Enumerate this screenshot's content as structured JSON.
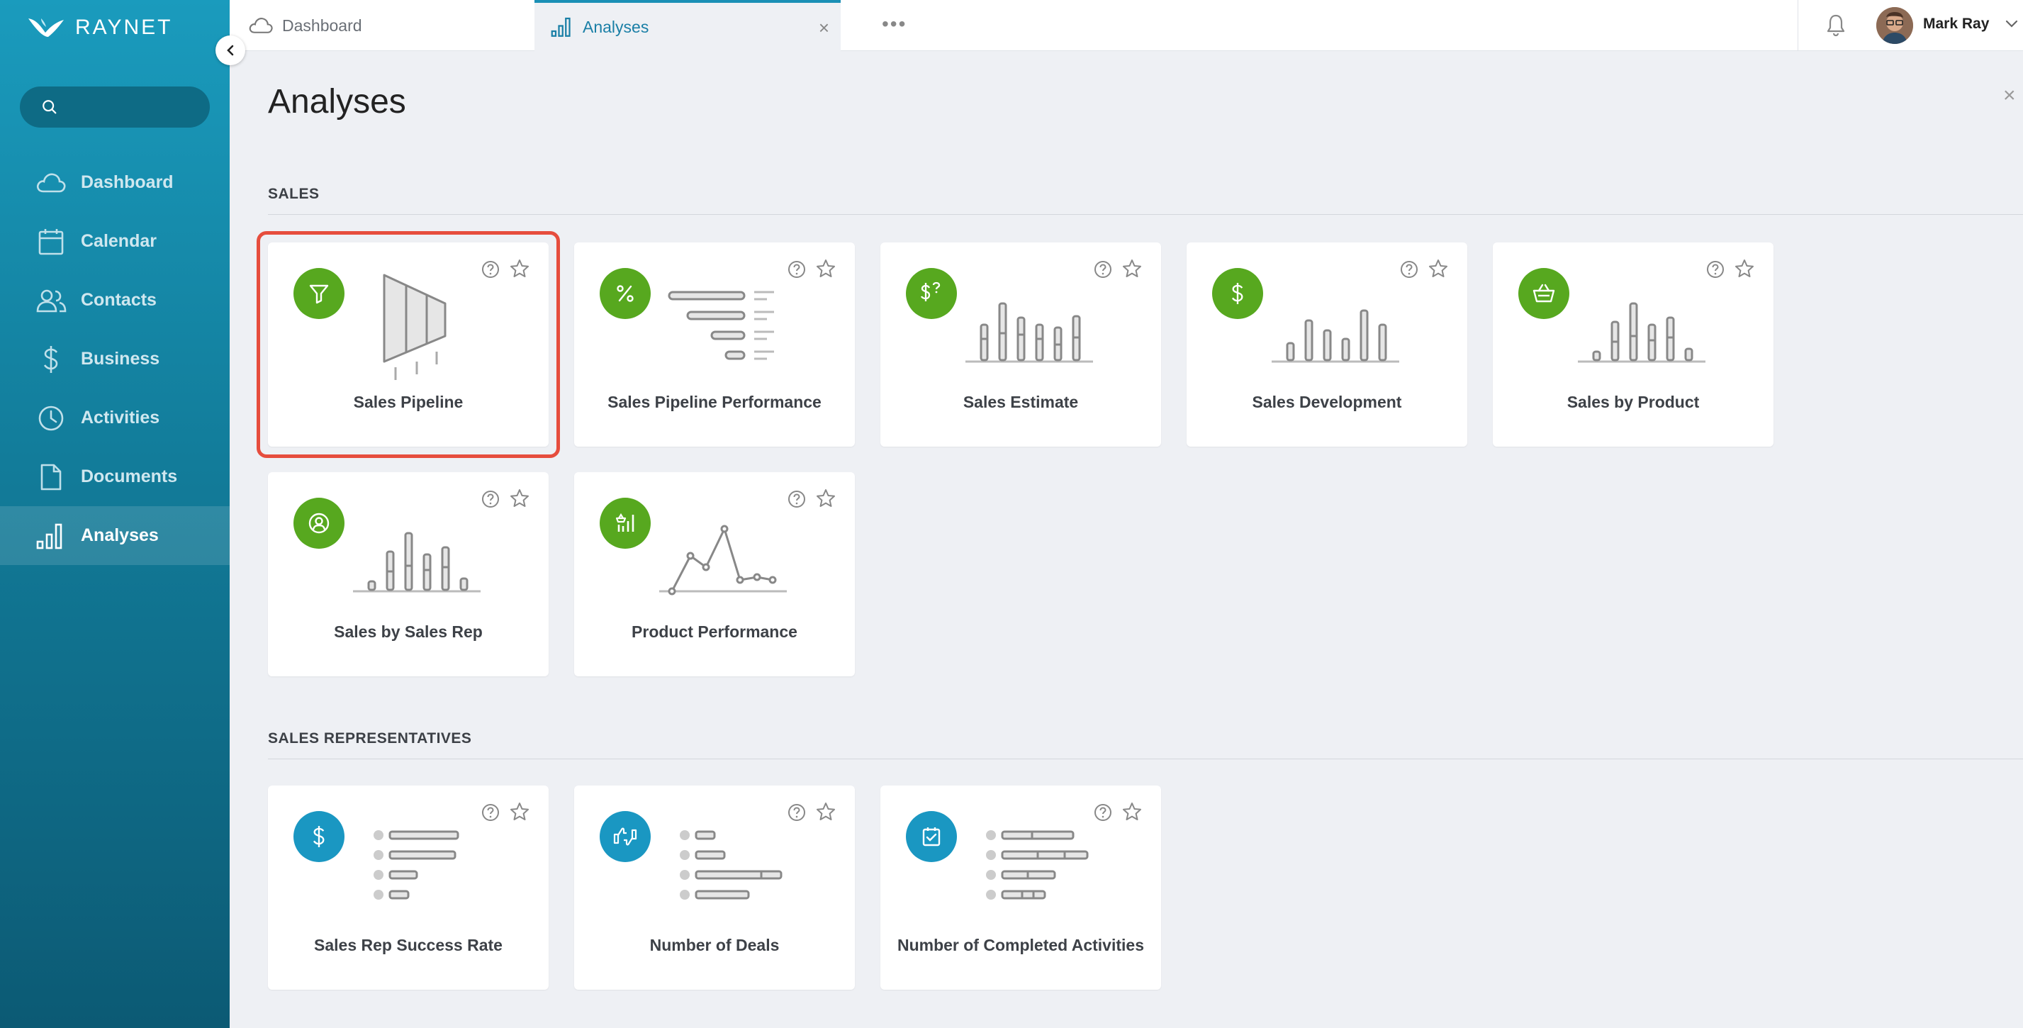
{
  "brand": {
    "name": "RAYNET"
  },
  "sidebar": {
    "search_placeholder": "",
    "items": [
      {
        "label": "Dashboard",
        "icon": "cloud-icon"
      },
      {
        "label": "Calendar",
        "icon": "calendar-icon"
      },
      {
        "label": "Contacts",
        "icon": "contacts-icon"
      },
      {
        "label": "Business",
        "icon": "dollar-icon"
      },
      {
        "label": "Activities",
        "icon": "clock-icon"
      },
      {
        "label": "Documents",
        "icon": "document-icon"
      },
      {
        "label": "Analyses",
        "icon": "bar-chart-icon",
        "active": true
      }
    ]
  },
  "tabs": [
    {
      "label": "Dashboard"
    },
    {
      "label": "Analyses",
      "active": true
    }
  ],
  "user": {
    "name": "Mark Ray"
  },
  "page": {
    "title": "Analyses"
  },
  "sections": [
    {
      "title": "SALES",
      "cards": [
        {
          "label": "Sales Pipeline",
          "badge": "funnel-icon",
          "color": "green",
          "selected": true
        },
        {
          "label": "Sales Pipeline Performance",
          "badge": "percent-icon",
          "color": "green"
        },
        {
          "label": "Sales Estimate",
          "badge": "dollar-question-icon",
          "color": "green"
        },
        {
          "label": "Sales Development",
          "badge": "dollar-icon",
          "color": "green"
        },
        {
          "label": "Sales by Product",
          "badge": "basket-icon",
          "color": "green"
        },
        {
          "label": "Sales by Sales Rep",
          "badge": "user-circle-icon",
          "color": "green"
        },
        {
          "label": "Product Performance",
          "badge": "product-chart-icon",
          "color": "green"
        }
      ]
    },
    {
      "title": "SALES REPRESENTATIVES",
      "cards": [
        {
          "label": "Sales Rep Success Rate",
          "badge": "dollar-icon",
          "color": "blue"
        },
        {
          "label": "Number of Deals",
          "badge": "thumbs-icon",
          "color": "blue"
        },
        {
          "label": "Number of Completed Activities",
          "badge": "checkbox-icon",
          "color": "blue"
        }
      ]
    }
  ],
  "colors": {
    "green": "#57a81f",
    "blue": "#1a97c2",
    "accent": "#1a8fb5",
    "highlight": "#e64d3d"
  }
}
